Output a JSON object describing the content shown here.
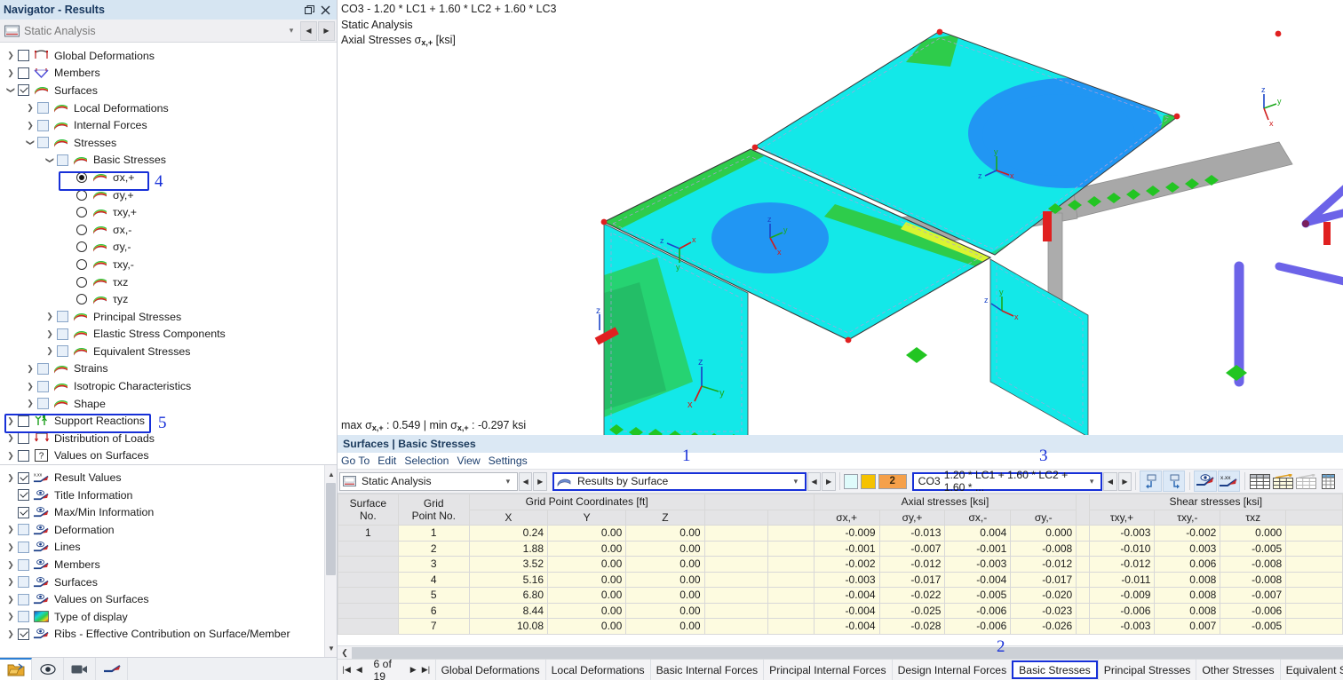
{
  "navigator": {
    "title": "Navigator - Results",
    "window_buttons": [
      "restore-icon",
      "close-icon"
    ],
    "selector": {
      "value": "Static Analysis",
      "icon": "analysis-icon"
    },
    "tree": [
      {
        "label": "Global Deformations",
        "indent": 0,
        "expander": ">",
        "control": "checkbox",
        "state": "off",
        "icon": "deformation-icon"
      },
      {
        "label": "Members",
        "indent": 0,
        "expander": ">",
        "control": "checkbox",
        "state": "off",
        "icon": "member-icon"
      },
      {
        "label": "Surfaces",
        "indent": 0,
        "expander": "v",
        "control": "checkbox",
        "state": "checked",
        "icon": "surface-icon"
      },
      {
        "label": "Local Deformations",
        "indent": 1,
        "expander": ">",
        "control": "checkbox-blue",
        "state": "off",
        "icon": "surface-icon"
      },
      {
        "label": "Internal Forces",
        "indent": 1,
        "expander": ">",
        "control": "checkbox-blue",
        "state": "off",
        "icon": "surface-icon"
      },
      {
        "label": "Stresses",
        "indent": 1,
        "expander": "v",
        "control": "checkbox-blue",
        "state": "off",
        "icon": "surface-icon"
      },
      {
        "label": "Basic Stresses",
        "indent": 2,
        "expander": "v",
        "control": "checkbox-blue",
        "state": "off",
        "icon": "surface-icon"
      },
      {
        "label": "σx,+",
        "indent": 3,
        "expander": "",
        "control": "radio",
        "state": "on",
        "icon": "surface-icon"
      },
      {
        "label": "σy,+",
        "indent": 3,
        "expander": "",
        "control": "radio",
        "state": "off",
        "icon": "surface-icon"
      },
      {
        "label": "τxy,+",
        "indent": 3,
        "expander": "",
        "control": "radio",
        "state": "off",
        "icon": "surface-icon"
      },
      {
        "label": "σx,-",
        "indent": 3,
        "expander": "",
        "control": "radio",
        "state": "off",
        "icon": "surface-icon"
      },
      {
        "label": "σy,-",
        "indent": 3,
        "expander": "",
        "control": "radio",
        "state": "off",
        "icon": "surface-icon"
      },
      {
        "label": "τxy,-",
        "indent": 3,
        "expander": "",
        "control": "radio",
        "state": "off",
        "icon": "surface-icon"
      },
      {
        "label": "τxz",
        "indent": 3,
        "expander": "",
        "control": "radio",
        "state": "off",
        "icon": "surface-icon"
      },
      {
        "label": "τyz",
        "indent": 3,
        "expander": "",
        "control": "radio",
        "state": "off",
        "icon": "surface-icon"
      },
      {
        "label": "Principal Stresses",
        "indent": 2,
        "expander": ">",
        "control": "checkbox-blue",
        "state": "off",
        "icon": "surface-icon"
      },
      {
        "label": "Elastic Stress Components",
        "indent": 2,
        "expander": ">",
        "control": "checkbox-blue",
        "state": "off",
        "icon": "surface-icon"
      },
      {
        "label": "Equivalent Stresses",
        "indent": 2,
        "expander": ">",
        "control": "checkbox-blue",
        "state": "off",
        "icon": "surface-icon"
      },
      {
        "label": "Strains",
        "indent": 1,
        "expander": ">",
        "control": "checkbox-blue",
        "state": "off",
        "icon": "surface-icon"
      },
      {
        "label": "Isotropic Characteristics",
        "indent": 1,
        "expander": ">",
        "control": "checkbox-blue",
        "state": "off",
        "icon": "surface-icon"
      },
      {
        "label": "Shape",
        "indent": 1,
        "expander": ">",
        "control": "checkbox-blue",
        "state": "off",
        "icon": "surface-icon"
      },
      {
        "label": "Support Reactions",
        "indent": 0,
        "expander": ">",
        "control": "checkbox",
        "state": "off",
        "icon": "support-icon"
      },
      {
        "label": "Distribution of Loads",
        "indent": 0,
        "expander": ">",
        "control": "checkbox",
        "state": "off",
        "icon": "load-icon"
      },
      {
        "label": "Values on Surfaces",
        "indent": 0,
        "expander": ">",
        "control": "checkbox",
        "state": "off",
        "icon": "question-icon"
      }
    ],
    "display_tree": [
      {
        "label": "Result Values",
        "expander": ">",
        "state": "checked",
        "icon": "result-values-icon"
      },
      {
        "label": "Title Information",
        "expander": "",
        "state": "checked",
        "icon": "eye-icon"
      },
      {
        "label": "Max/Min Information",
        "expander": "",
        "state": "checked",
        "icon": "eye-icon"
      },
      {
        "label": "Deformation",
        "expander": ">",
        "state": "off",
        "icon": "eye-icon"
      },
      {
        "label": "Lines",
        "expander": ">",
        "state": "off",
        "icon": "eye-icon"
      },
      {
        "label": "Members",
        "expander": ">",
        "state": "off",
        "icon": "eye-icon"
      },
      {
        "label": "Surfaces",
        "expander": ">",
        "state": "off",
        "icon": "eye-icon"
      },
      {
        "label": "Values on Surfaces",
        "expander": ">",
        "state": "off",
        "icon": "eye-icon"
      },
      {
        "label": "Type of display",
        "expander": ">",
        "state": "off",
        "icon": "color-scale-icon"
      },
      {
        "label": "Ribs - Effective Contribution on Surface/Member",
        "expander": ">",
        "state": "checked",
        "icon": "eye-icon"
      }
    ],
    "bottom_tabs": [
      "project-icon",
      "view-icon",
      "camera-icon",
      "display-icon"
    ]
  },
  "annotations": [
    {
      "number": "1",
      "target": "results-by-surface-combo"
    },
    {
      "number": "2",
      "target": "basic-stresses-tab"
    },
    {
      "number": "3",
      "target": "load-combination-combo"
    },
    {
      "number": "4",
      "target": "sigma-x-plus-radio"
    },
    {
      "number": "5",
      "target": "support-reactions-item"
    }
  ],
  "viewport": {
    "title_line1": "CO3 - 1.20 * LC1 + 1.60 * LC2 + 1.60 * LC3",
    "title_line2": "Static Analysis",
    "title_line3_pre": "Axial Stresses σ",
    "title_line3_sub": "x,+",
    "title_line3_post": " [ksi]",
    "minmax_max_pre": "max σ",
    "minmax_sub": "x,+",
    "minmax_max_val": " : 0.549  |  min σ",
    "minmax_min_val": " : -0.297 ksi",
    "colors": {
      "surface_base": "#13E8E8",
      "surface_blue": "#2196F3",
      "surface_green": "#2ECC4B",
      "surface_green_dark": "#21B060",
      "member_purple": "#6C63E8",
      "member_gray": "#A8A8A8",
      "support_green": "#22C522",
      "node_red": "#E02020"
    }
  },
  "table_panel": {
    "header": "Surfaces | Basic Stresses",
    "menu": [
      "Go To",
      "Edit",
      "Selection",
      "View",
      "Settings"
    ],
    "analysis_combo": "Static Analysis",
    "results_combo": "Results by Surface",
    "load_combo_id": "CO3",
    "load_combo_text": "1.20 * LC1 + 1.60 * LC2 + 1.60 * ...",
    "legend_swatches": [
      "#DFFBFB",
      "#F5C200",
      "#F5A04A"
    ],
    "legend_number": "2",
    "toolbar_icons": [
      "undo-icon",
      "redo-icon",
      "show-values-icon",
      "result-values-icon",
      "table-all-icon",
      "table-filter-icon",
      "table-empty-icon",
      "table-export-icon"
    ],
    "columns": {
      "group_coords": "Grid Point Coordinates [ft]",
      "group_axial": "Axial stresses [ksi]",
      "group_shear": "Shear stresses [ksi]",
      "surface_no_l1": "Surface",
      "surface_no_l2": "No.",
      "grid_pt_l1": "Grid",
      "grid_pt_l2": "Point No.",
      "x": "X",
      "y": "Y",
      "z": "Z",
      "sx_plus": "σx,+",
      "sy_plus": "σy,+",
      "sx_minus": "σx,-",
      "sy_minus": "σy,-",
      "txy_plus": "τxy,+",
      "txy_minus": "τxy,-",
      "txz": "τxz"
    },
    "rows": [
      {
        "surface": "1",
        "point": "1",
        "x": "0.24",
        "y": "0.00",
        "z": "0.00",
        "sx_plus": "-0.009",
        "sy_plus": "-0.013",
        "sx_minus": "0.004",
        "sy_minus": "0.000",
        "txy_plus": "-0.003",
        "txy_minus": "-0.002",
        "txz": "0.000"
      },
      {
        "surface": "",
        "point": "2",
        "x": "1.88",
        "y": "0.00",
        "z": "0.00",
        "sx_plus": "-0.001",
        "sy_plus": "-0.007",
        "sx_minus": "-0.001",
        "sy_minus": "-0.008",
        "txy_plus": "-0.010",
        "txy_minus": "0.003",
        "txz": "-0.005"
      },
      {
        "surface": "",
        "point": "3",
        "x": "3.52",
        "y": "0.00",
        "z": "0.00",
        "sx_plus": "-0.002",
        "sy_plus": "-0.012",
        "sx_minus": "-0.003",
        "sy_minus": "-0.012",
        "txy_plus": "-0.012",
        "txy_minus": "0.006",
        "txz": "-0.008"
      },
      {
        "surface": "",
        "point": "4",
        "x": "5.16",
        "y": "0.00",
        "z": "0.00",
        "sx_plus": "-0.003",
        "sy_plus": "-0.017",
        "sx_minus": "-0.004",
        "sy_minus": "-0.017",
        "txy_plus": "-0.011",
        "txy_minus": "0.008",
        "txz": "-0.008"
      },
      {
        "surface": "",
        "point": "5",
        "x": "6.80",
        "y": "0.00",
        "z": "0.00",
        "sx_plus": "-0.004",
        "sy_plus": "-0.022",
        "sx_minus": "-0.005",
        "sy_minus": "-0.020",
        "txy_plus": "-0.009",
        "txy_minus": "0.008",
        "txz": "-0.007"
      },
      {
        "surface": "",
        "point": "6",
        "x": "8.44",
        "y": "0.00",
        "z": "0.00",
        "sx_plus": "-0.004",
        "sy_plus": "-0.025",
        "sx_minus": "-0.006",
        "sy_minus": "-0.023",
        "txy_plus": "-0.006",
        "txy_minus": "0.008",
        "txz": "-0.006"
      },
      {
        "surface": "",
        "point": "7",
        "x": "10.08",
        "y": "0.00",
        "z": "0.00",
        "sx_plus": "-0.004",
        "sy_plus": "-0.028",
        "sx_minus": "-0.006",
        "sy_minus": "-0.026",
        "txy_plus": "-0.003",
        "txy_minus": "0.007",
        "txz": "-0.005"
      }
    ],
    "pagination": {
      "text": "6 of 19",
      "first": "|◀",
      "prev": "◀",
      "next": "▶",
      "last": "▶|"
    },
    "tabs": [
      {
        "label": "Global Deformations",
        "active": false
      },
      {
        "label": "Local Deformations",
        "active": false
      },
      {
        "label": "Basic Internal Forces",
        "active": false
      },
      {
        "label": "Principal Internal Forces",
        "active": false
      },
      {
        "label": "Design Internal Forces",
        "active": false
      },
      {
        "label": "Basic Stresses",
        "active": true
      },
      {
        "label": "Principal Stresses",
        "active": false
      },
      {
        "label": "Other Stresses",
        "active": false
      },
      {
        "label": "Equivalent Stresses - von Mises",
        "active": false
      }
    ]
  }
}
